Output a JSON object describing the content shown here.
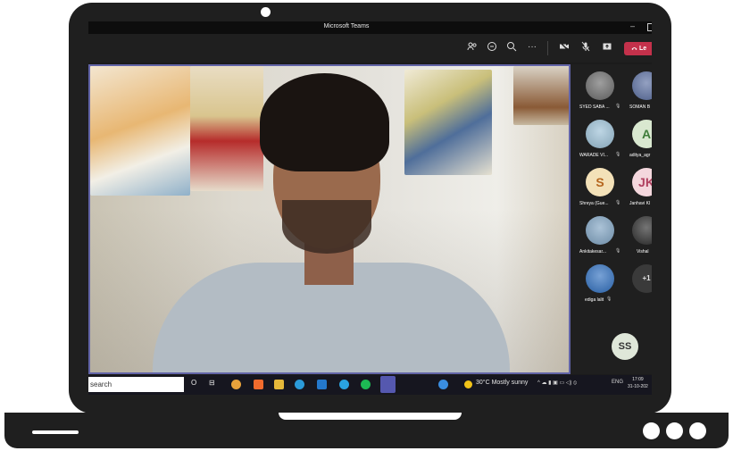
{
  "window": {
    "title": "Microsoft Teams",
    "minimize": "–"
  },
  "toolbar": {
    "more": "···",
    "leave_label": "Le"
  },
  "participants": [
    {
      "name": "SYED SABA ...",
      "initial": "",
      "color": "#6b6b6b",
      "photo": true
    },
    {
      "name": "SOMAN B",
      "initial": "",
      "color": "#5a6ea0",
      "photo": true
    },
    {
      "name": "WARADE VI...",
      "initial": "",
      "color": "#9bc0d6",
      "photo": true
    },
    {
      "name": "aditya_agr",
      "initial": "A",
      "color": "#d9e8d0",
      "photo": false
    },
    {
      "name": "Shreya (Gue...",
      "initial": "S",
      "color": "#f3e1b8",
      "photo": false
    },
    {
      "name": "Janhavi Kl",
      "initial": "JK",
      "color": "#f4d7dd",
      "photo": false
    },
    {
      "name": "Ankitakesar...",
      "initial": "",
      "color": "#7fa3c2",
      "photo": true
    },
    {
      "name": "Vishal",
      "initial": "",
      "color": "#2b2b2b",
      "photo": true
    },
    {
      "name": "ediga lalit",
      "initial": "",
      "color": "#2f6fbf",
      "photo": true
    },
    {
      "name": "",
      "initial": "+1",
      "color": "#3a3a3a",
      "photo": false
    }
  ],
  "self": {
    "initials": "SS"
  },
  "taskbar": {
    "search_text": "search",
    "weather": "30°C  Mostly sunny",
    "lang": "ENG",
    "time": "17:09",
    "date": "31-10-202"
  },
  "colors": {
    "accent": "#6264a7",
    "leave": "#c4314b"
  }
}
